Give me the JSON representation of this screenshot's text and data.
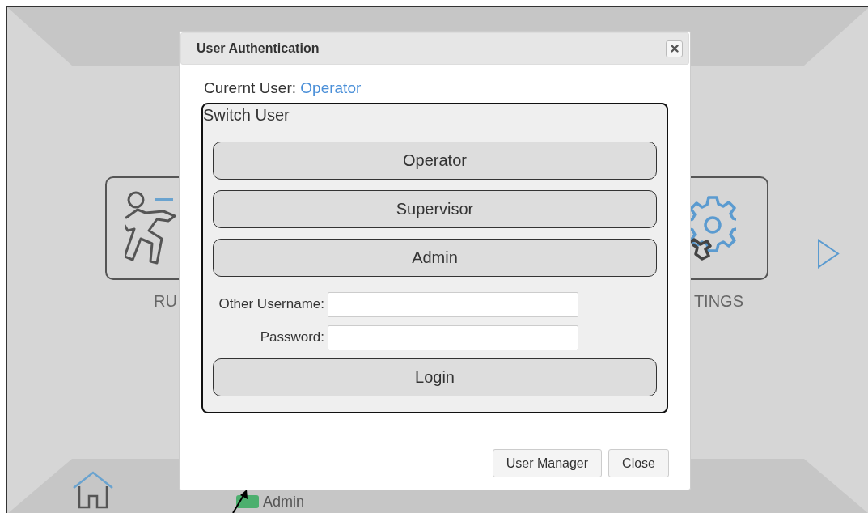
{
  "background": {
    "tiles": [
      {
        "kind": "run",
        "label": "RU"
      },
      {
        "kind": "settings",
        "label": "TINGS"
      }
    ],
    "footer": {
      "user": "Admin"
    }
  },
  "dialog": {
    "title": "User Authentication",
    "current_user_label": "Curernt User:",
    "current_user": "Operator",
    "switch_title": "Switch User",
    "users": [
      "Operator",
      "Supervisor",
      "Admin"
    ],
    "fields": [
      {
        "label": "Other Username:"
      },
      {
        "label": "Password:"
      }
    ],
    "login": "Login",
    "buttons": [
      "User Manager",
      "Close"
    ]
  }
}
